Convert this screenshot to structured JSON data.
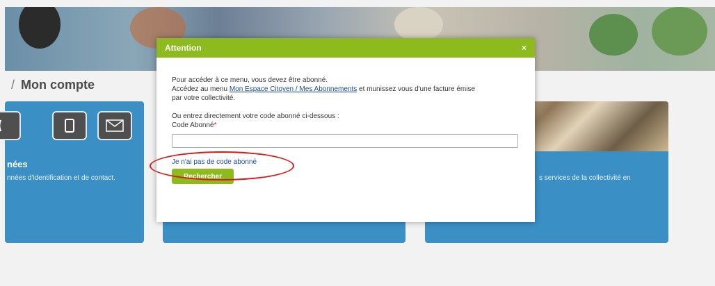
{
  "page": {
    "title": "Mon compte",
    "separator": "/"
  },
  "cards": {
    "left": {
      "title": "nées",
      "text": "nnées d'identification et de contact."
    },
    "right": {
      "text": "s services de la collectivité en"
    }
  },
  "modal": {
    "title": "Attention",
    "close_label": "×",
    "line1": "Pour accéder à ce menu, vous devez être abonné.",
    "line2_before": "Accédez au menu ",
    "line2_link": "Mon Espace Citoyen / Mes Abonnements",
    "line2_after": " et munissez vous d'une facture émise",
    "line3": "par votre collectivité.",
    "line4": "Ou entrez directement votre code abonné ci-dessous :",
    "code_label": "Code Abonné",
    "required_mark": "*",
    "code_value": "",
    "no_code_link": "Je n'ai pas de code abonné",
    "search_button": "Rechercher"
  },
  "colors": {
    "accent_green": "#8dba1c",
    "card_blue": "#3a8fc5",
    "annotation_red": "#e01515",
    "link_blue": "#1a4aa8"
  },
  "icons": [
    "phone-icon",
    "tablet-icon",
    "envelope-icon",
    "close-icon"
  ]
}
